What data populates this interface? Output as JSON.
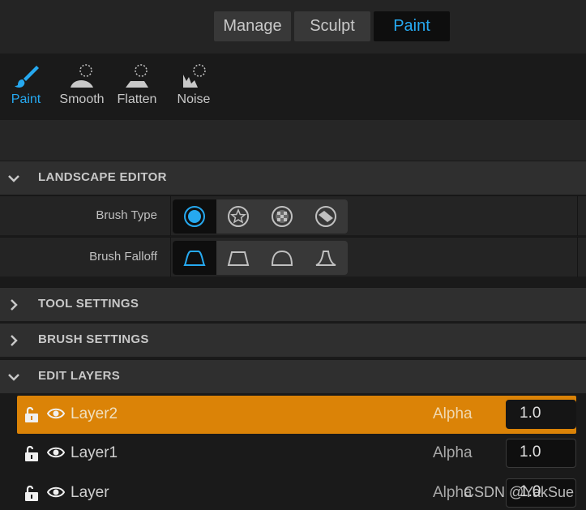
{
  "mode_tabs": [
    {
      "label": "Manage",
      "active": false
    },
    {
      "label": "Sculpt",
      "active": false
    },
    {
      "label": "Paint",
      "active": true
    }
  ],
  "tools": [
    {
      "label": "Paint",
      "icon": "paint-brush-icon",
      "active": true
    },
    {
      "label": "Smooth",
      "icon": "smooth-icon",
      "active": false
    },
    {
      "label": "Flatten",
      "icon": "flatten-icon",
      "active": false
    },
    {
      "label": "Noise",
      "icon": "noise-icon",
      "active": false
    }
  ],
  "sections": {
    "landscape_editor": {
      "title": "LANDSCAPE EDITOR",
      "expanded": true
    },
    "tool_settings": {
      "title": "TOOL SETTINGS",
      "expanded": false
    },
    "brush_settings": {
      "title": "BRUSH SETTINGS",
      "expanded": false
    },
    "edit_layers": {
      "title": "EDIT LAYERS",
      "expanded": true
    }
  },
  "brush_type": {
    "label": "Brush Type",
    "options": [
      "circle-brush-icon",
      "alpha-brush-icon",
      "pattern-brush-icon",
      "component-brush-icon"
    ],
    "selected": 0
  },
  "brush_falloff": {
    "label": "Brush Falloff",
    "options": [
      "smooth-falloff-icon",
      "linear-falloff-icon",
      "spherical-falloff-icon",
      "tip-falloff-icon"
    ],
    "selected": 0
  },
  "layers": [
    {
      "name": "Layer2",
      "alpha_label": "Alpha",
      "alpha": "1.0",
      "selected": true
    },
    {
      "name": "Layer1",
      "alpha_label": "Alpha",
      "alpha": "1.0",
      "selected": false
    },
    {
      "name": "Layer",
      "alpha_label": "Alpha",
      "alpha": "1.0",
      "selected": false
    }
  ],
  "watermark": "CSDN @YakSue",
  "colors": {
    "accent": "#26a9f0",
    "selected_layer": "#db8307"
  }
}
